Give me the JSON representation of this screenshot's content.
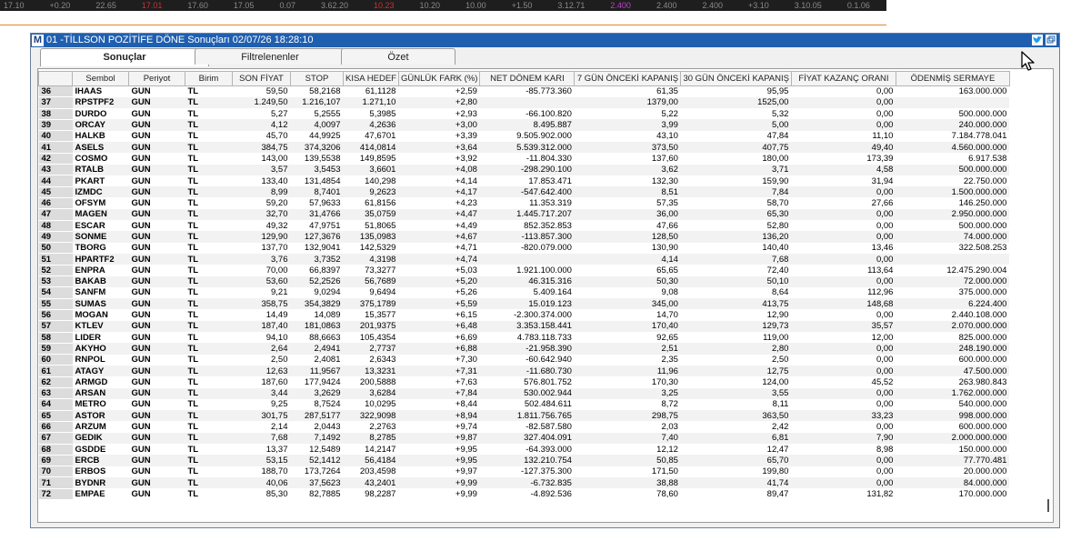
{
  "ticker": {
    "items": [
      "17.10",
      "+0.20",
      "22.65",
      "17.01",
      "17.60",
      "17.05",
      "0.07",
      "3.62.20",
      "10.23",
      "10.20",
      "10.00",
      "+1.50",
      "3.12.71",
      "2.400",
      "2.400",
      "2.400",
      "+3.10",
      "3.10.05",
      "0.1.06",
      "1.00"
    ]
  },
  "window": {
    "logo": "M",
    "title": "01 -TİLLSON POZİTİFE DÖNE Sonuçları  02/07/26 18:28:10",
    "tabs": [
      "Sonuçlar",
      "Filtrelenenler",
      "Özet"
    ]
  },
  "table": {
    "columns": [
      "",
      "Sembol",
      "Periyot",
      "Birim",
      "SON FİYAT",
      "STOP",
      "KISA HEDEF",
      "GÜNLÜK FARK (%)",
      "NET DÖNEM KARI",
      "7 GÜN ÖNCEKİ KAPANIŞ",
      "30 GÜN ÖNCEKİ KAPANIŞ",
      "FİYAT KAZANÇ ORANI",
      "ÖDENMİŞ SERMAYE"
    ],
    "rows": [
      [
        "36",
        "IHAAS",
        "GUN",
        "TL",
        "59,50",
        "58,2168",
        "61,1128",
        "+2,59",
        "-85.773.360",
        "61,35",
        "95,95",
        "0,00",
        "163.000.000"
      ],
      [
        "37",
        "RPSTPF2",
        "GUN",
        "TL",
        "1.249,50",
        "1.216,107",
        "1.271,10",
        "+2,80",
        "",
        "1379,00",
        "1525,00",
        "0,00",
        ""
      ],
      [
        "38",
        "DURDO",
        "GUN",
        "TL",
        "5,27",
        "5,2555",
        "5,3985",
        "+2,93",
        "-66.100.820",
        "5,22",
        "5,32",
        "0,00",
        "500.000.000"
      ],
      [
        "39",
        "ORCAY",
        "GUN",
        "TL",
        "4,12",
        "4,0097",
        "4,2636",
        "+3,00",
        "8.495.887",
        "3,99",
        "5,00",
        "0,00",
        "240.000.000"
      ],
      [
        "40",
        "HALKB",
        "GUN",
        "TL",
        "45,70",
        "44,9925",
        "47,6701",
        "+3,39",
        "9.505.902.000",
        "43,10",
        "47,84",
        "11,10",
        "7.184.778.041"
      ],
      [
        "41",
        "ASELS",
        "GUN",
        "TL",
        "384,75",
        "374,3206",
        "414,0814",
        "+3,64",
        "5.539.312.000",
        "373,50",
        "407,75",
        "49,40",
        "4.560.000.000"
      ],
      [
        "42",
        "COSMO",
        "GUN",
        "TL",
        "143,00",
        "139,5538",
        "149,8595",
        "+3,92",
        "-11.804.330",
        "137,60",
        "180,00",
        "173,39",
        "6.917.538"
      ],
      [
        "43",
        "RTALB",
        "GUN",
        "TL",
        "3,57",
        "3,5453",
        "3,6601",
        "+4,08",
        "-298.290.100",
        "3,62",
        "3,71",
        "4,58",
        "500.000.000"
      ],
      [
        "44",
        "PKART",
        "GUN",
        "TL",
        "133,40",
        "131,4854",
        "140,298",
        "+4,14",
        "17.853.471",
        "132,30",
        "159,90",
        "31,94",
        "22.750.000"
      ],
      [
        "45",
        "IZMDC",
        "GUN",
        "TL",
        "8,99",
        "8,7401",
        "9,2623",
        "+4,17",
        "-547.642.400",
        "8,51",
        "7,84",
        "0,00",
        "1.500.000.000"
      ],
      [
        "46",
        "OFSYM",
        "GUN",
        "TL",
        "59,20",
        "57,9633",
        "61,8156",
        "+4,23",
        "11.353.319",
        "57,35",
        "58,70",
        "27,66",
        "146.250.000"
      ],
      [
        "47",
        "MAGEN",
        "GUN",
        "TL",
        "32,70",
        "31,4766",
        "35,0759",
        "+4,47",
        "1.445.717.207",
        "36,00",
        "65,30",
        "0,00",
        "2.950.000.000"
      ],
      [
        "48",
        "ESCAR",
        "GUN",
        "TL",
        "49,32",
        "47,9751",
        "51,8065",
        "+4,49",
        "852.352.853",
        "47,66",
        "52,80",
        "0,00",
        "500.000.000"
      ],
      [
        "49",
        "SONME",
        "GUN",
        "TL",
        "129,90",
        "127,3676",
        "135,0983",
        "+4,67",
        "-113.857.300",
        "128,50",
        "136,20",
        "0,00",
        "74.000.000"
      ],
      [
        "50",
        "TBORG",
        "GUN",
        "TL",
        "137,70",
        "132,9041",
        "142,5329",
        "+4,71",
        "-820.079.000",
        "130,90",
        "140,40",
        "13,46",
        "322.508.253"
      ],
      [
        "51",
        "HPARTF2",
        "GUN",
        "TL",
        "3,76",
        "3,7352",
        "4,3198",
        "+4,74",
        "",
        "4,14",
        "7,68",
        "0,00",
        ""
      ],
      [
        "52",
        "ENPRA",
        "GUN",
        "TL",
        "70,00",
        "66,8397",
        "73,3277",
        "+5,03",
        "1.921.100.000",
        "65,65",
        "72,40",
        "113,64",
        "12.475.290.004"
      ],
      [
        "53",
        "BAKAB",
        "GUN",
        "TL",
        "53,60",
        "52,2526",
        "56,7689",
        "+5,20",
        "46.315.316",
        "50,30",
        "50,10",
        "0,00",
        "72.000.000"
      ],
      [
        "54",
        "SANFM",
        "GUN",
        "TL",
        "9,21",
        "9,0294",
        "9,6494",
        "+5,26",
        "5.409.164",
        "9,08",
        "8,64",
        "112,96",
        "375.000.000"
      ],
      [
        "55",
        "SUMAS",
        "GUN",
        "TL",
        "358,75",
        "354,3829",
        "375,1789",
        "+5,59",
        "15.019.123",
        "345,00",
        "413,75",
        "148,68",
        "6.224.400"
      ],
      [
        "56",
        "MOGAN",
        "GUN",
        "TL",
        "14,49",
        "14,089",
        "15,3577",
        "+6,15",
        "-2.300.374.000",
        "14,70",
        "12,90",
        "0,00",
        "2.440.108.000"
      ],
      [
        "57",
        "KTLEV",
        "GUN",
        "TL",
        "187,40",
        "181,0863",
        "201,9375",
        "+6,48",
        "3.353.158.441",
        "170,40",
        "129,73",
        "35,57",
        "2.070.000.000"
      ],
      [
        "58",
        "LIDER",
        "GUN",
        "TL",
        "94,10",
        "88,6663",
        "105,4354",
        "+6,69",
        "4.783.118.733",
        "92,65",
        "119,00",
        "12,00",
        "825.000.000"
      ],
      [
        "59",
        "AKYHO",
        "GUN",
        "TL",
        "2,64",
        "2,4941",
        "2,7737",
        "+6,88",
        "-21.958.390",
        "2,51",
        "2,80",
        "0,00",
        "248.190.000"
      ],
      [
        "60",
        "RNPOL",
        "GUN",
        "TL",
        "2,50",
        "2,4081",
        "2,6343",
        "+7,30",
        "-60.642.940",
        "2,35",
        "2,50",
        "0,00",
        "600.000.000"
      ],
      [
        "61",
        "ATAGY",
        "GUN",
        "TL",
        "12,63",
        "11,9567",
        "13,3231",
        "+7,31",
        "-11.680.730",
        "11,96",
        "12,75",
        "0,00",
        "47.500.000"
      ],
      [
        "62",
        "ARMGD",
        "GUN",
        "TL",
        "187,60",
        "177,9424",
        "200,5888",
        "+7,63",
        "576.801.752",
        "170,30",
        "124,00",
        "45,52",
        "263.980.843"
      ],
      [
        "63",
        "ARSAN",
        "GUN",
        "TL",
        "3,44",
        "3,2629",
        "3,6284",
        "+7,84",
        "530.002.944",
        "3,25",
        "3,55",
        "0,00",
        "1.762.000.000"
      ],
      [
        "64",
        "METRO",
        "GUN",
        "TL",
        "9,25",
        "8,7524",
        "10,0295",
        "+8,44",
        "502.484.611",
        "8,72",
        "8,11",
        "0,00",
        "540.000.000"
      ],
      [
        "65",
        "ASTOR",
        "GUN",
        "TL",
        "301,75",
        "287,5177",
        "322,9098",
        "+8,94",
        "1.811.756.765",
        "298,75",
        "363,50",
        "33,23",
        "998.000.000"
      ],
      [
        "66",
        "ARZUM",
        "GUN",
        "TL",
        "2,14",
        "2,0443",
        "2,2763",
        "+9,74",
        "-82.587.580",
        "2,03",
        "2,42",
        "0,00",
        "600.000.000"
      ],
      [
        "67",
        "GEDIK",
        "GUN",
        "TL",
        "7,68",
        "7,1492",
        "8,2785",
        "+9,87",
        "327.404.091",
        "7,40",
        "6,81",
        "7,90",
        "2.000.000.000"
      ],
      [
        "68",
        "GSDDE",
        "GUN",
        "TL",
        "13,37",
        "12,5489",
        "14,2147",
        "+9,95",
        "-64.393.000",
        "12,12",
        "12,47",
        "8,98",
        "150.000.000"
      ],
      [
        "69",
        "ERCB",
        "GUN",
        "TL",
        "53,15",
        "52,1412",
        "56,4184",
        "+9,95",
        "132.210.754",
        "50,85",
        "65,70",
        "0,00",
        "77.770.481"
      ],
      [
        "70",
        "ERBOS",
        "GUN",
        "TL",
        "188,70",
        "173,7264",
        "203,4598",
        "+9,97",
        "-127.375.300",
        "171,50",
        "199,80",
        "0,00",
        "20.000.000"
      ],
      [
        "71",
        "BYDNR",
        "GUN",
        "TL",
        "40,06",
        "37,5623",
        "43,2401",
        "+9,99",
        "-6.732.835",
        "38,88",
        "41,74",
        "0,00",
        "84.000.000"
      ],
      [
        "72",
        "EMPAE",
        "GUN",
        "TL",
        "85,30",
        "82,7885",
        "98,2287",
        "+9,99",
        "-4.892.536",
        "78,60",
        "89,47",
        "131,82",
        "170.000.000"
      ]
    ]
  }
}
